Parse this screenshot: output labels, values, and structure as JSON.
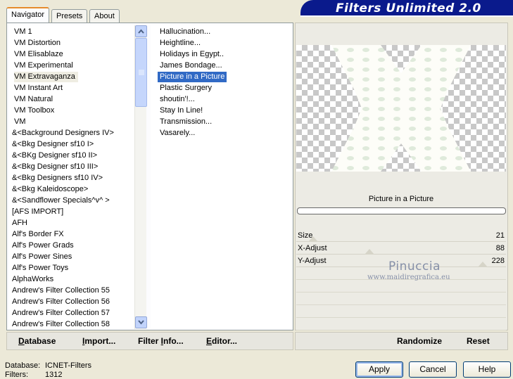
{
  "title": "Filters Unlimited 2.0",
  "tabs": [
    {
      "label": "Navigator",
      "active": true
    },
    {
      "label": "Presets",
      "active": false
    },
    {
      "label": "About",
      "active": false
    }
  ],
  "categories": [
    {
      "label": "VM 1"
    },
    {
      "label": "VM Distortion"
    },
    {
      "label": "VM Elisablaze"
    },
    {
      "label": "VM Experimental"
    },
    {
      "label": "VM Extravaganza",
      "selected": true
    },
    {
      "label": "VM Instant Art"
    },
    {
      "label": "VM Natural"
    },
    {
      "label": "VM Toolbox"
    },
    {
      "label": "VM"
    },
    {
      "label": "&<Background Designers IV>"
    },
    {
      "label": "&<Bkg Designer sf10 I>"
    },
    {
      "label": "&<BKg Designer sf10 II>"
    },
    {
      "label": "&<Bkg Designer sf10 III>"
    },
    {
      "label": "&<Bkg Designers sf10 IV>"
    },
    {
      "label": "&<Bkg Kaleidoscope>"
    },
    {
      "label": "&<Sandflower Specials^v^ >"
    },
    {
      "label": "[AFS IMPORT]"
    },
    {
      "label": "AFH"
    },
    {
      "label": "Alf's Border FX"
    },
    {
      "label": "Alf's Power Grads"
    },
    {
      "label": "Alf's Power Sines"
    },
    {
      "label": "Alf's Power Toys"
    },
    {
      "label": "AlphaWorks"
    },
    {
      "label": "Andrew's Filter Collection 55"
    },
    {
      "label": "Andrew's Filter Collection 56"
    },
    {
      "label": "Andrew's Filter Collection 57"
    },
    {
      "label": "Andrew's Filter Collection 58"
    }
  ],
  "filters": [
    {
      "label": "Hallucination..."
    },
    {
      "label": "Heightline..."
    },
    {
      "label": "Holidays in Egypt.."
    },
    {
      "label": "James Bondage..."
    },
    {
      "label": "Picture in a Picture",
      "selected": true
    },
    {
      "label": "Plastic Surgery"
    },
    {
      "label": "shoutin'!..."
    },
    {
      "label": "Stay In Line!"
    },
    {
      "label": "Transmission..."
    },
    {
      "label": "Vasarely..."
    }
  ],
  "selected_filter_name": "Picture in a Picture",
  "sliders": [
    {
      "label": "Size",
      "value": "21",
      "level": 0.08
    },
    {
      "label": "X-Adjust",
      "value": "88",
      "level": 0.35
    },
    {
      "label": "Y-Adjust",
      "value": "228",
      "level": 0.89
    }
  ],
  "watermark": {
    "name": "Pinuccia",
    "url": "www.maidiregrafica.eu"
  },
  "toolbar": {
    "database": {
      "underline": "D",
      "rest": "atabase"
    },
    "import": {
      "underline": "I",
      "rest": "mport..."
    },
    "filter_info": {
      "pre": "Filter ",
      "underline": "I",
      "rest": "nfo..."
    },
    "editor": {
      "underline": "E",
      "rest": "ditor..."
    },
    "randomize": "Randomize",
    "reset": "Reset"
  },
  "footer": {
    "database_label": "Database:",
    "database_value": "ICNET-Filters",
    "filters_label": "Filters:",
    "filters_value": "1312"
  },
  "buttons": {
    "apply": "Apply",
    "cancel": "Cancel",
    "help": "Help"
  },
  "colors": {
    "banner": "#0a1a8c",
    "selection": "#316ac5"
  }
}
